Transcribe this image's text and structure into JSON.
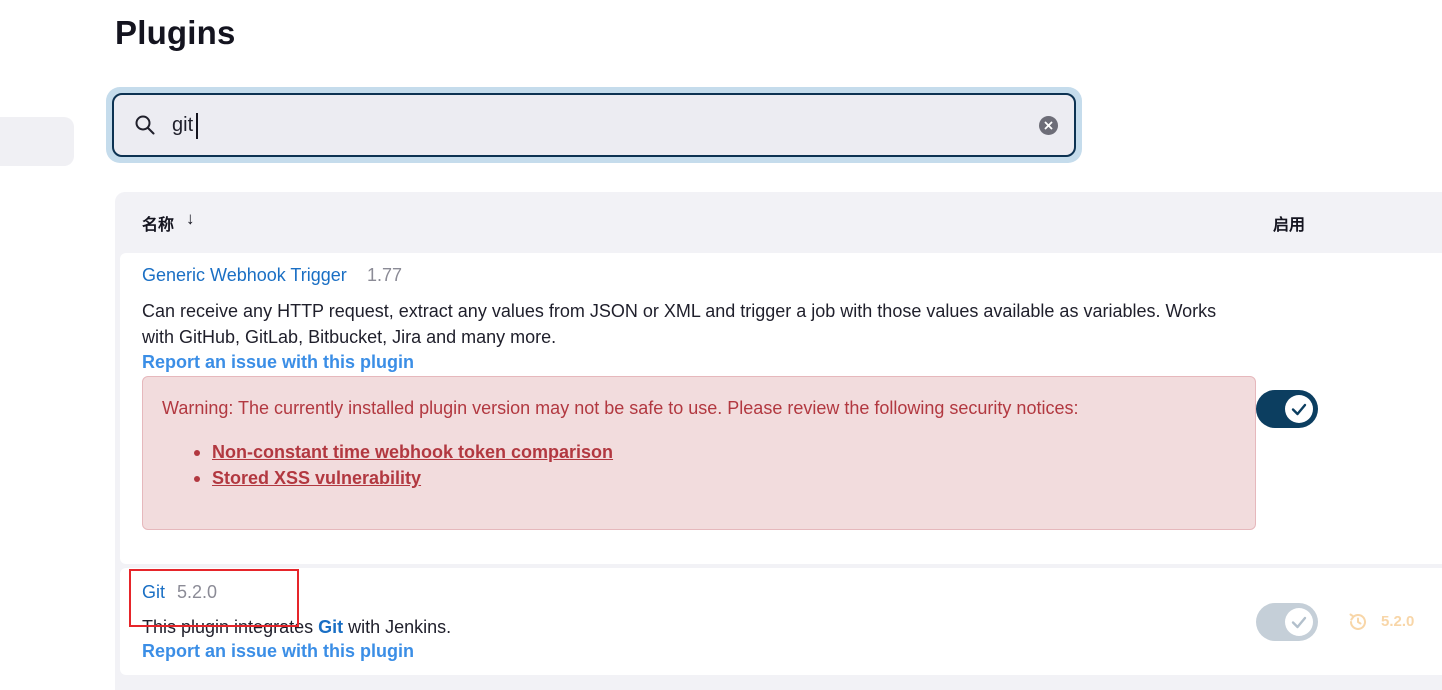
{
  "header": {
    "title": "Plugins"
  },
  "search": {
    "value": "git",
    "placeholder": ""
  },
  "table": {
    "columns": {
      "name": "名称",
      "sort_indicator": "↓",
      "enabled": "启用"
    }
  },
  "plugins": [
    {
      "name": "Generic Webhook Trigger",
      "version": "1.77",
      "description_line1": "Can receive any HTTP request, extract any values from JSON or XML and trigger a job with those values available as variables. Works",
      "description_line2": "with GitHub, GitLab, Bitbucket, Jira and many more.",
      "report_link": "Report an issue with this plugin",
      "warning": {
        "text": "Warning: The currently installed plugin version may not be safe to use. Please review the following security notices:",
        "notices": [
          "Non-constant time webhook token comparison",
          "Stored XSS vulnerability"
        ]
      },
      "enabled": true
    },
    {
      "name": "Git",
      "version": "5.2.0",
      "description_prefix": "This plugin integrates ",
      "description_strong": "Git",
      "description_suffix": " with Jenkins.",
      "report_link": "Report an issue with this plugin",
      "enabled": true,
      "toggle_disabled": true,
      "downgrade_version": "5.2.0"
    }
  ],
  "colors": {
    "link": "#1a6fc4",
    "toggle_on": "#0c3e60",
    "warning_bg": "#f2dcdd",
    "warning_text": "#b23840",
    "highlight": "#e6252a"
  },
  "icons": {
    "search": "search-icon",
    "clear": "clear-icon",
    "check": "check-icon",
    "downgrade": "downgrade-icon"
  }
}
